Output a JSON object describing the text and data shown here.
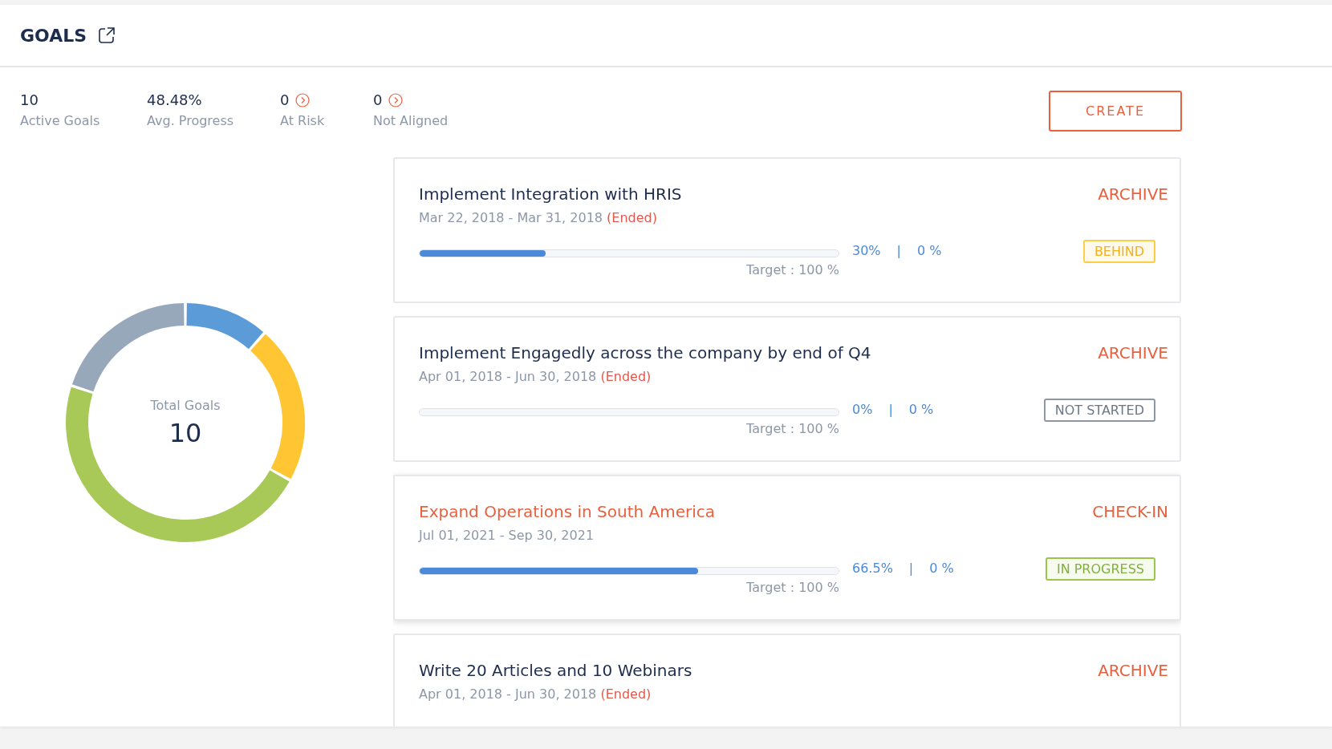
{
  "header": {
    "title": "GOALS"
  },
  "stats": [
    {
      "value": "10",
      "label": "Active Goals",
      "linked": false
    },
    {
      "value": "48.48%",
      "label": "Avg. Progress",
      "linked": false
    },
    {
      "value": "0",
      "label": "At Risk",
      "linked": true
    },
    {
      "value": "0",
      "label": "Not Aligned",
      "linked": true
    }
  ],
  "create_button": "CREATE",
  "donut": {
    "label": "Total Goals",
    "value": "10"
  },
  "goals": [
    {
      "title": "Implement Integration with HRIS",
      "dates": "Mar 22, 2018 - Mar 31, 2018",
      "ended": "(Ended)",
      "action": "ARCHIVE",
      "selected": false,
      "level": 0.3,
      "percent": "30%",
      "separator": "|",
      "actual": "0 %",
      "target": "Target : 100 %",
      "status": {
        "label": "BEHIND",
        "kind": "behind"
      }
    },
    {
      "title": "Implement Engagedly across the company by end of Q4",
      "dates": "Apr 01, 2018 - Jun 30, 2018",
      "ended": "(Ended)",
      "action": "ARCHIVE",
      "selected": false,
      "level": 0,
      "percent": "0%",
      "separator": "|",
      "actual": "0 %",
      "target": "Target : 100 %",
      "status": {
        "label": "NOT STARTED",
        "kind": "not_started"
      }
    },
    {
      "title": "Expand Operations in South America",
      "dates": "Jul 01, 2021 - Sep 30, 2021",
      "action": "CHECK-IN",
      "selected": true,
      "level": 0.665,
      "percent": "66.5%",
      "separator": "|",
      "actual": "0 %",
      "target": "Target : 100 %",
      "status": {
        "label": "IN PROGRESS",
        "kind": "in_progress"
      }
    },
    {
      "title": "Write 20 Articles and 10 Webinars",
      "dates": "Apr 01, 2018 - Jun 30, 2018",
      "ended": "(Ended)",
      "action": "ARCHIVE",
      "selected": false
    }
  ]
}
